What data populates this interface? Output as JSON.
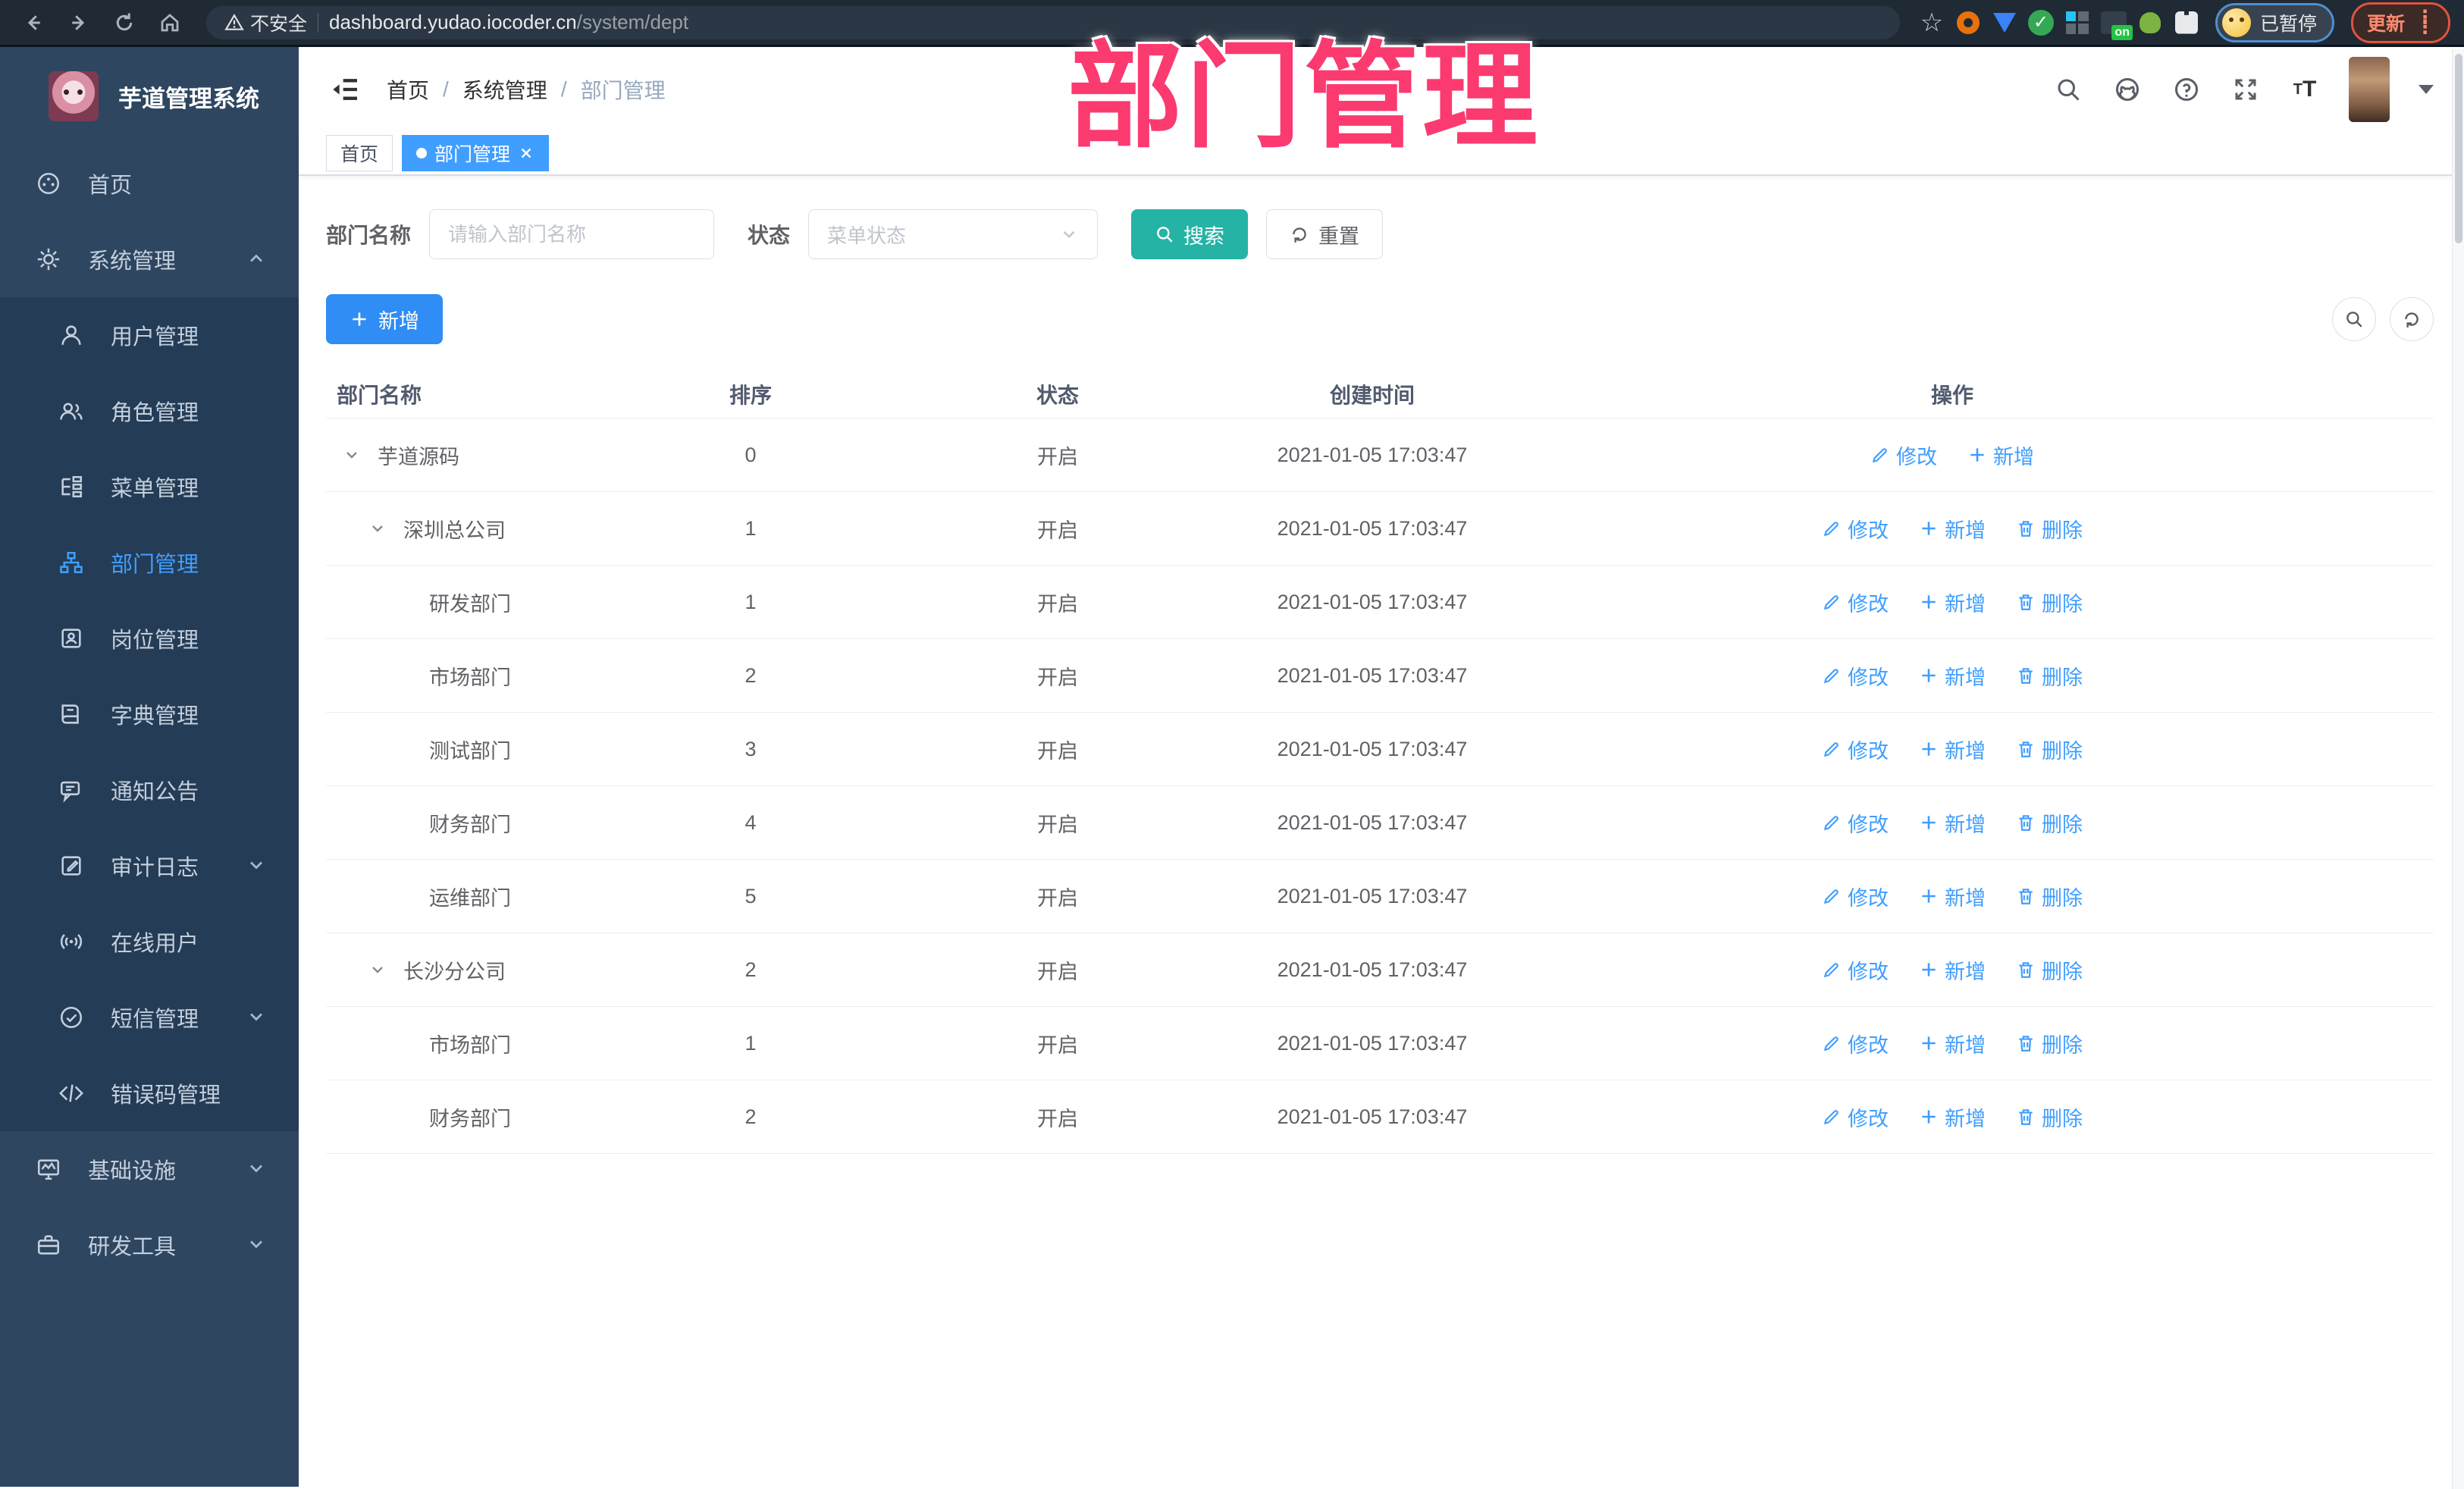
{
  "browser": {
    "security_label": "不安全",
    "url_host": "dashboard.yudao.iocoder.cn",
    "url_path": "/system/dept",
    "profile_status": "已暂停",
    "update_label": "更新",
    "extension_badge": "on",
    "nav_icons": [
      "back-icon",
      "forward-icon",
      "reload-icon",
      "home-icon"
    ],
    "toolbar_icons": [
      "bookmark-star-icon",
      "extension-orange-icon",
      "extension-gem-icon",
      "extension-green-check-icon",
      "extension-grid-icon",
      "extension-on-icon",
      "extension-key-icon",
      "extensions-puzzle-icon"
    ]
  },
  "sidebar": {
    "title": "芋道管理系统",
    "items": [
      {
        "id": "home",
        "icon": "dashboard-icon",
        "label": "首页",
        "type": "top",
        "chevron": ""
      },
      {
        "id": "system",
        "icon": "gear-icon",
        "label": "系统管理",
        "type": "top",
        "chevron": "up"
      },
      {
        "id": "user",
        "icon": "user-icon",
        "label": "用户管理",
        "type": "sub",
        "chevron": ""
      },
      {
        "id": "role",
        "icon": "users-icon",
        "label": "角色管理",
        "type": "sub",
        "chevron": ""
      },
      {
        "id": "menu",
        "icon": "menu-tree-icon",
        "label": "菜单管理",
        "type": "sub",
        "chevron": ""
      },
      {
        "id": "dept",
        "icon": "org-chart-icon",
        "label": "部门管理",
        "type": "sub",
        "chevron": "",
        "active": true
      },
      {
        "id": "post",
        "icon": "id-badge-icon",
        "label": "岗位管理",
        "type": "sub",
        "chevron": ""
      },
      {
        "id": "dict",
        "icon": "book-icon",
        "label": "字典管理",
        "type": "sub",
        "chevron": ""
      },
      {
        "id": "notice",
        "icon": "bullhorn-icon",
        "label": "通知公告",
        "type": "sub",
        "chevron": ""
      },
      {
        "id": "audit",
        "icon": "log-edit-icon",
        "label": "审计日志",
        "type": "sub",
        "chevron": "down"
      },
      {
        "id": "online",
        "icon": "online-icon",
        "label": "在线用户",
        "type": "sub",
        "chevron": ""
      },
      {
        "id": "sms",
        "icon": "sms-check-icon",
        "label": "短信管理",
        "type": "sub",
        "chevron": "down"
      },
      {
        "id": "errcode",
        "icon": "code-icon",
        "label": "错误码管理",
        "type": "sub",
        "chevron": ""
      },
      {
        "id": "infra",
        "icon": "monitor-icon",
        "label": "基础设施",
        "type": "top",
        "chevron": "down"
      },
      {
        "id": "devtool",
        "icon": "toolbox-icon",
        "label": "研发工具",
        "type": "top",
        "chevron": "down"
      }
    ]
  },
  "header": {
    "breadcrumb": {
      "0": "首页",
      "1": "系统管理",
      "2": "部门管理"
    },
    "right_icons": [
      "search-icon",
      "github-icon",
      "help-icon",
      "fullscreen-icon",
      "font-size-icon",
      "avatar",
      "caret-down-icon"
    ]
  },
  "tabs": {
    "0": {
      "label": "首页"
    },
    "1": {
      "label": "部门管理"
    }
  },
  "filters": {
    "dept_label": "部门名称",
    "dept_placeholder": "请输入部门名称",
    "status_label": "状态",
    "status_placeholder": "菜单状态",
    "search_label": "搜索",
    "reset_label": "重置"
  },
  "toolbar": {
    "add_label": "新增"
  },
  "watermark": "部门管理",
  "colors": {
    "accent": "#409EFF",
    "search_teal": "#25b3a5",
    "add_blue": "#2f8df5",
    "watermark_pink": "#fb3a70",
    "sidebar_bg": "#2e4660",
    "submenu_bg": "#243c55"
  },
  "table": {
    "columns": {
      "name": "部门名称",
      "sort": "排序",
      "status": "状态",
      "created": "创建时间",
      "ops": "操作"
    },
    "action_labels": {
      "edit": "修改",
      "add": "新增",
      "del": "删除"
    },
    "rows": [
      {
        "level": 0,
        "expandable": true,
        "name": "芋道源码",
        "sort": "0",
        "status": "开启",
        "created": "2021-01-05 17:03:47",
        "can_delete": false
      },
      {
        "level": 1,
        "expandable": true,
        "name": "深圳总公司",
        "sort": "1",
        "status": "开启",
        "created": "2021-01-05 17:03:47",
        "can_delete": true
      },
      {
        "level": 2,
        "expandable": false,
        "name": "研发部门",
        "sort": "1",
        "status": "开启",
        "created": "2021-01-05 17:03:47",
        "can_delete": true
      },
      {
        "level": 2,
        "expandable": false,
        "name": "市场部门",
        "sort": "2",
        "status": "开启",
        "created": "2021-01-05 17:03:47",
        "can_delete": true
      },
      {
        "level": 2,
        "expandable": false,
        "name": "测试部门",
        "sort": "3",
        "status": "开启",
        "created": "2021-01-05 17:03:47",
        "can_delete": true
      },
      {
        "level": 2,
        "expandable": false,
        "name": "财务部门",
        "sort": "4",
        "status": "开启",
        "created": "2021-01-05 17:03:47",
        "can_delete": true
      },
      {
        "level": 2,
        "expandable": false,
        "name": "运维部门",
        "sort": "5",
        "status": "开启",
        "created": "2021-01-05 17:03:47",
        "can_delete": true
      },
      {
        "level": 1,
        "expandable": true,
        "name": "长沙分公司",
        "sort": "2",
        "status": "开启",
        "created": "2021-01-05 17:03:47",
        "can_delete": true
      },
      {
        "level": 2,
        "expandable": false,
        "name": "市场部门",
        "sort": "1",
        "status": "开启",
        "created": "2021-01-05 17:03:47",
        "can_delete": true
      },
      {
        "level": 2,
        "expandable": false,
        "name": "财务部门",
        "sort": "2",
        "status": "开启",
        "created": "2021-01-05 17:03:47",
        "can_delete": true
      }
    ]
  }
}
